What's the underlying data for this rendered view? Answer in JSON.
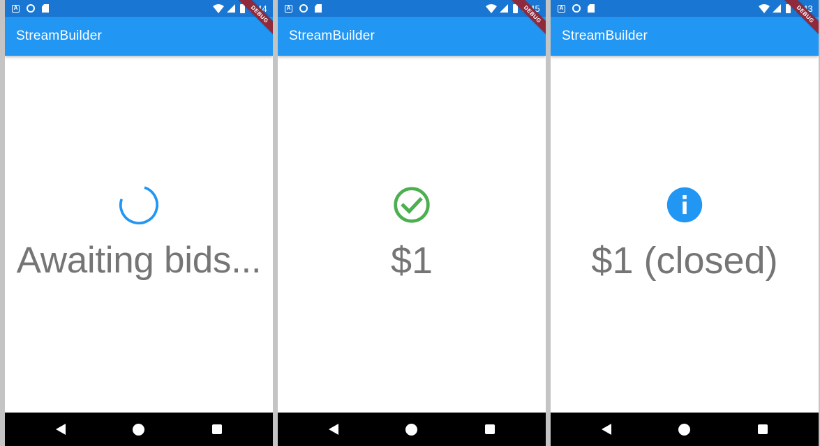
{
  "screens": [
    {
      "status_time": "5:44",
      "app_title": "StreamBuilder",
      "debug_label": "DEBUG",
      "state_icon": "progress-spinner-icon",
      "state_text": "Awaiting bids...",
      "icon_color": "#2196f3"
    },
    {
      "status_time": "5:45",
      "app_title": "StreamBuilder",
      "debug_label": "DEBUG",
      "state_icon": "check-circle-icon",
      "state_text": "$1",
      "icon_color": "#4caf50"
    },
    {
      "status_time": "5:43",
      "app_title": "StreamBuilder",
      "debug_label": "DEBUG",
      "state_icon": "info-icon",
      "state_text": "$1 (closed)",
      "icon_color": "#2196f3"
    }
  ],
  "colors": {
    "status_bar": "#1976d2",
    "app_bar": "#2196f3",
    "text_grey": "#757575",
    "debug_ribbon": "#8e2a3c",
    "nav_bar": "#000000",
    "divider": "#c4c4c4"
  },
  "status_icons": [
    "a-notification-icon",
    "circle-notification-icon",
    "sd-card-icon",
    "wifi-icon",
    "signal-icon",
    "battery-icon"
  ],
  "nav_icons": [
    "back-icon",
    "home-icon",
    "recents-icon"
  ]
}
